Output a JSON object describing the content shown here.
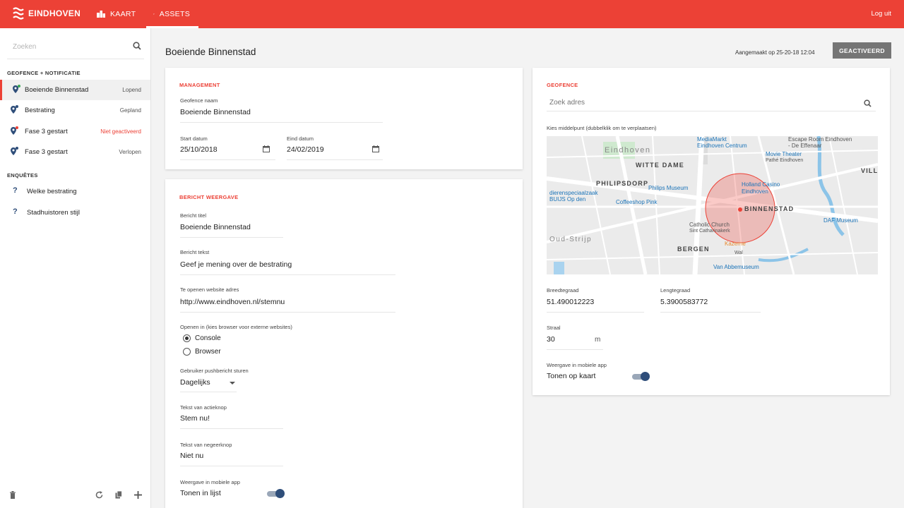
{
  "header": {
    "brand": "EINDHOVEN",
    "nav": [
      {
        "label": "KAART",
        "icon": "buildings-icon"
      },
      {
        "label": "ASSETS",
        "icon": "gears-icon"
      }
    ],
    "logout": "Log uit",
    "colors": {
      "brand": "#ec4136",
      "accent": "#2f4e7a"
    }
  },
  "sidebar": {
    "search_placeholder": "Zoeken",
    "section_geofence": "GEOFENCE + NOTIFICATIE",
    "geofences": [
      {
        "label": "Boeiende Binnenstad",
        "status": "Lopend",
        "dot": "#3aa657"
      },
      {
        "label": "Bestrating",
        "status": "Gepland",
        "dot": "#2f4e7a"
      },
      {
        "label": "Fase 3 gestart",
        "status": "Niet geactiveerd",
        "dot": "#ec4136"
      },
      {
        "label": "Fase 3 gestart",
        "status": "Verlopen",
        "dot": "#2f4e7a"
      }
    ],
    "section_enquetes": "ENQUÊTES",
    "enquetes": [
      {
        "label": "Welke bestrating"
      },
      {
        "label": "Stadhuistoren stijl"
      }
    ]
  },
  "page": {
    "title": "Boeiende Binnenstad",
    "created": "Aangemaakt op 25-20-18 12:04",
    "activate_button": "GEACTIVEERD"
  },
  "management": {
    "title": "MANAGEMENT",
    "name_label": "Geofence naam",
    "name_value": "Boeiende Binnenstad",
    "start_label": "Start datum",
    "start_value": "25/10/2018",
    "end_label": "Eind datum",
    "end_value": "24/02/2019"
  },
  "message": {
    "title": "BERICHT WEERGAVE",
    "msg_title_label": "Bericht titel",
    "msg_title_value": "Boeiende Binnenstad",
    "msg_text_label": "Bericht tekst",
    "msg_text_value": "Geef je mening over de bestrating",
    "url_label": "Te openen website adres",
    "url_value": "http://www.eindhoven.nl/stemnu",
    "open_in_label": "Openen in (kies browser voor externe websites)",
    "open_options": [
      "Console",
      "Browser"
    ],
    "push_label": "Gebruiker pushbericht sturen",
    "push_value": "Dagelijks",
    "action_label": "Tekst van actieknop",
    "action_value": "Stem nu!",
    "ignore_label": "Tekst van negeerknop",
    "ignore_value": "Niet nu",
    "display_label": "Weergave in mobiele app",
    "display_value": "Tonen in lijst"
  },
  "geofence": {
    "title": "GEOFENCE",
    "search_placeholder": "Zoek adres",
    "center_label": "Kies middelpunt (dubbelklik om te verplaatsen)",
    "map_labels": {
      "eindhoven": "Eindhoven",
      "witte_dame": "WITTE DAME",
      "philipsdorp": "PHILIPSDORP",
      "binnenstad": "BINNENSTAD",
      "bergen": "BERGEN",
      "oud_strijp": "Oud-Strijp",
      "villa": "VILLA",
      "mediamarkt": "MediaMarkt",
      "mediamarkt2": "Eindhoven Centrum",
      "escape": "Escape Room Eindhoven",
      "escape2": "- De Effenaar",
      "movie": "Movie Theater",
      "movie2": "Pathé Eindhoven",
      "philips_museum": "Philips Museum",
      "casino": "Holland Casino",
      "casino2": "Eindhoven",
      "buijs": "dierenspeciaalzaak",
      "buijs2": "BUIJS Op den",
      "coffeeshop": "Coffeeshop Pink",
      "church": "Catholic Church",
      "church2": "Sint Catharinakerk",
      "kazerne": "Kazerne",
      "daf": "DAF Museum",
      "vanabbe": "Van Abbemuseum",
      "wal": "Wal"
    },
    "lat_label": "Breedtegraad",
    "lat_value": "51.490012223",
    "lng_label": "Lengtegraad",
    "lng_value": "5.3900583772",
    "radius_label": "Straal",
    "radius_value": "30",
    "radius_unit": "m",
    "display_label": "Weergave in mobiele app",
    "display_value": "Tonen op kaart"
  }
}
